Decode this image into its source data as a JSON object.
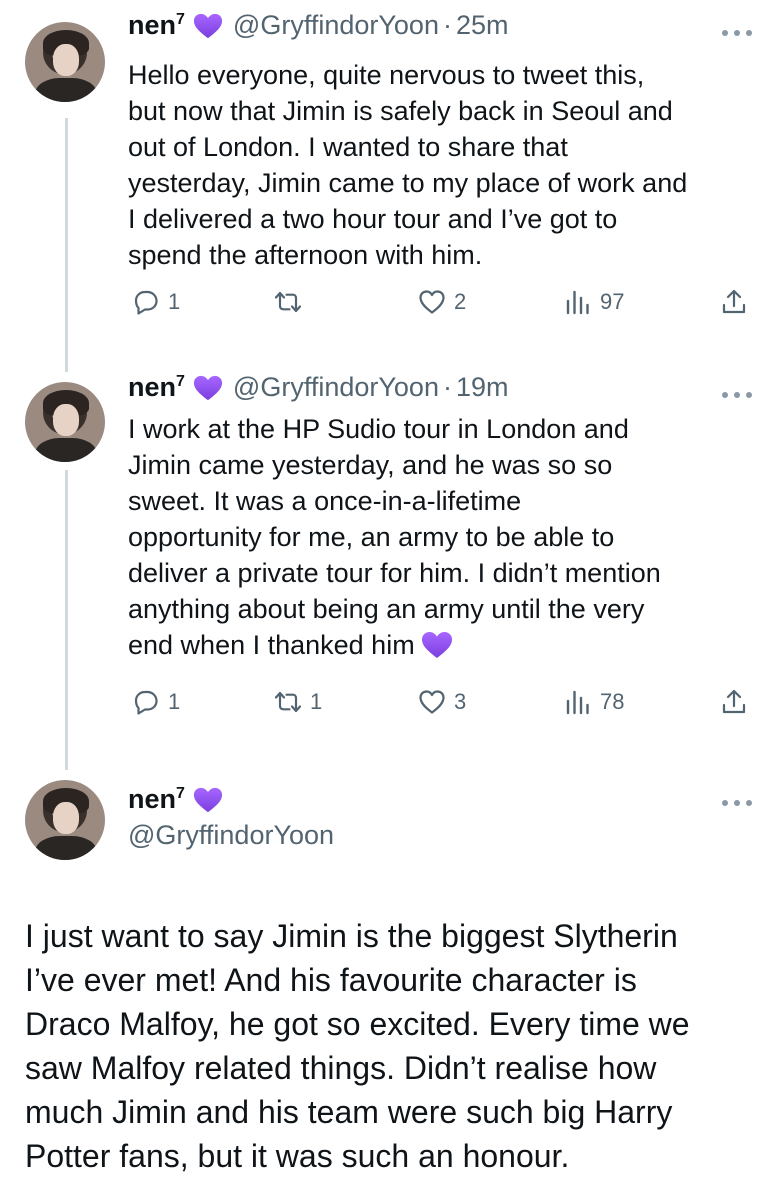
{
  "tweets": [
    {
      "name": "nen",
      "name_sup": "7",
      "handle": "@GryffindorYoon",
      "dot": "·",
      "time": "25m",
      "lines": [
        "Hello everyone, quite nervous to tweet this,",
        "but now that Jimin is safely back in Seoul and",
        "out of London. I wanted to share that",
        "yesterday, Jimin came to my place of work and",
        "I delivered a two hour tour and I’ve got to",
        "spend the afternoon with him."
      ],
      "replies": "1",
      "retweets": "",
      "likes": "2",
      "views": "97"
    },
    {
      "name": "nen",
      "name_sup": "7",
      "handle": "@GryffindorYoon",
      "dot": "·",
      "time": "19m",
      "lines": [
        "I work at the HP Sudio tour in London and",
        "Jimin came yesterday, and he was so so",
        "sweet.  It was a once-in-a-lifetime",
        "opportunity for me, an army to be able to",
        "deliver a private tour for him. I didn’t mention",
        "anything about being an army until the very",
        "end when I thanked him"
      ],
      "replies": "1",
      "retweets": "1",
      "likes": "3",
      "views": "78"
    }
  ],
  "main_tweet": {
    "name": "nen",
    "name_sup": "7",
    "handle": "@GryffindorYoon",
    "lines": [
      "I just want to say Jimin is the biggest Slytherin",
      "I’ve ever met! And his favourite character is",
      "Draco Malfoy, he got so excited. Every time we",
      "saw Malfoy related things. Didn’t realise how",
      "much Jimin and his team were such big Harry",
      "Potter fans, but it was such an honour."
    ]
  },
  "icons": {
    "verified_heart": "purple-heart-emoji",
    "reply": "reply-icon",
    "retweet": "retweet-icon",
    "like": "heart-outline-icon",
    "views": "views-bar-chart-icon",
    "share": "share-icon",
    "more": "more-dots-icon"
  },
  "colors": {
    "text": "#0f1419",
    "secondary": "#536471",
    "heart": "#8a4fe8",
    "thread_line": "#cfd9de"
  }
}
